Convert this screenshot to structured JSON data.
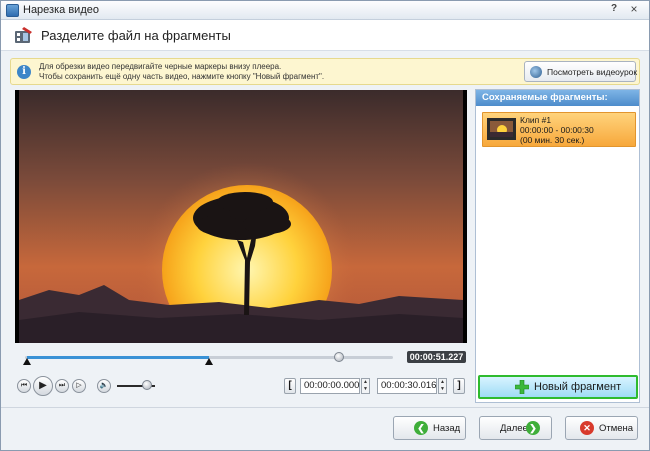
{
  "window": {
    "title": "Нарезка видео",
    "help": "?",
    "close": "×"
  },
  "header": {
    "title": "Разделите файл на фрагменты"
  },
  "hint": {
    "line1": "Для обрезки видео передвигайте черные маркеры внизу плеера.",
    "line2": "Чтобы сохранить ещё одну часть видео, нажмите кнопку \"Новый фрагмент\".",
    "tutorial_button": "Посмотреть видеоурок"
  },
  "player": {
    "current_time": "00:00:51.227",
    "selection_start": 0.0,
    "selection_end": 0.5,
    "playhead": 0.853,
    "volume": 0.8
  },
  "controls": {
    "start_time": "00:00:00.000",
    "end_time": "00:00:30.016",
    "bracket_start": "[",
    "bracket_end": "]"
  },
  "fragments": {
    "heading": "Сохраняемые фрагменты:",
    "items": [
      {
        "name": "Клип #1",
        "range": "00:00:00 - 00:00:30",
        "duration": "(00 мин. 30 сек.)"
      }
    ],
    "new_button": "Новый фрагмент"
  },
  "footer": {
    "back": "Назад",
    "next": "Далее",
    "cancel": "Отмена"
  },
  "colors": {
    "accent_green": "#2fbb2f",
    "selection_blue": "#3a92d6",
    "clip_orange": "#f7a83b"
  }
}
